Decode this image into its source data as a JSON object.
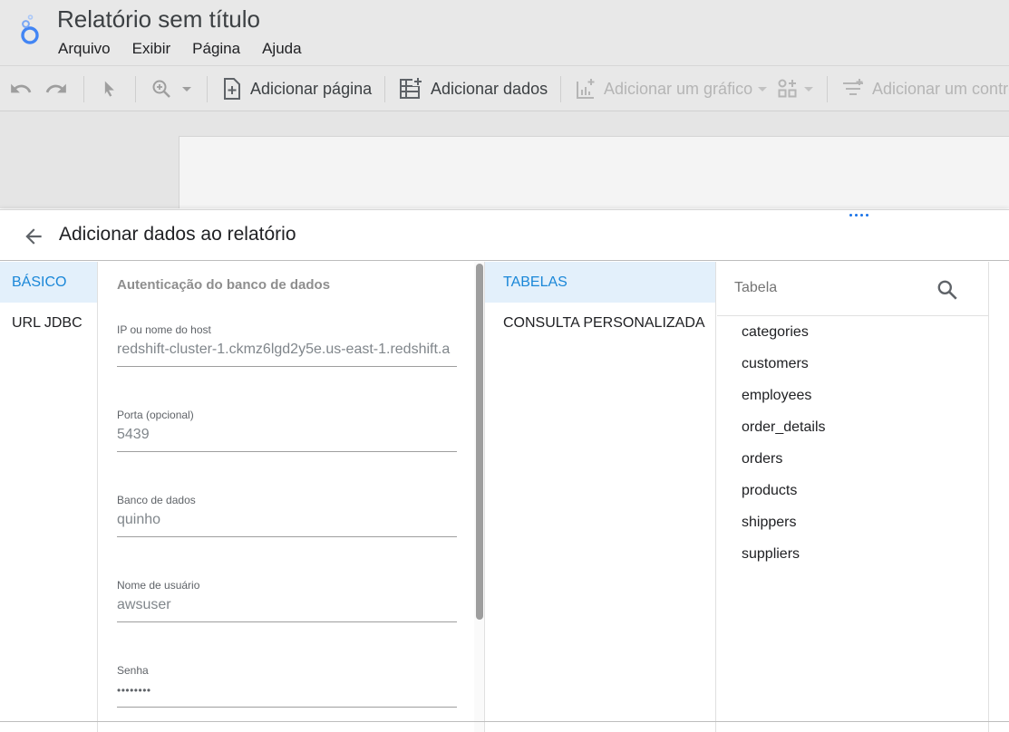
{
  "app": {
    "title": "Relatório sem título",
    "menu": [
      "Arquivo",
      "Exibir",
      "Página",
      "Ajuda"
    ]
  },
  "toolbar": {
    "add_page": "Adicionar página",
    "add_data": "Adicionar dados",
    "add_chart": "Adicionar um gráfico",
    "add_control": "Adicionar um controle"
  },
  "panel": {
    "title": "Adicionar dados ao relatório",
    "left_nav": [
      "BÁSICO",
      "URL JDBC"
    ],
    "form": {
      "section_title": "Autenticação do banco de dados",
      "fields": [
        {
          "label": "IP ou nome do host",
          "value": "redshift-cluster-1.ckmz6lgd2y5e.us-east-1.redshift.a"
        },
        {
          "label": "Porta (opcional)",
          "value": "5439"
        },
        {
          "label": "Banco de dados",
          "value": "quinho"
        },
        {
          "label": "Nome de usuário",
          "value": "awsuser"
        },
        {
          "label": "Senha",
          "value": "••••••••"
        }
      ]
    },
    "tabs": [
      "TABELAS",
      "CONSULTA PERSONALIZADA"
    ],
    "table_search": {
      "placeholder": "Tabela"
    },
    "tables": [
      "categories",
      "customers",
      "employees",
      "order_details",
      "orders",
      "products",
      "shippers",
      "suppliers"
    ]
  },
  "colors": {
    "accent": "#1a87d8",
    "active_bg": "#e3f0fb",
    "header_bg": "#e8e8e8"
  }
}
